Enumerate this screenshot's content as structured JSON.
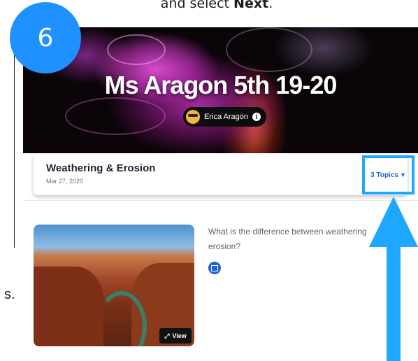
{
  "instruction": {
    "prefix": "and select ",
    "action": "Next",
    "suffix": "."
  },
  "step_number": "6",
  "side_fragment": "s.",
  "class": {
    "title": "Ms Aragon 5th 19-20",
    "author": "Erica Aragon"
  },
  "topic": {
    "title": "Weathering & Erosion",
    "date": "Mar 27, 2020",
    "topics_label": "3 Topics",
    "question": "What is the difference between weathering and erosion?",
    "question_line1": "What is the difference between weathering",
    "question_line2": "erosion?",
    "view_label": "View"
  },
  "colors": {
    "accent": "#1ea7ff",
    "link": "#1f65d6",
    "step_circle": "#1e90ff"
  },
  "icons": [
    "info-icon",
    "caret-down-icon",
    "expand-icon",
    "video-response-icon",
    "up-arrow-icon"
  ]
}
